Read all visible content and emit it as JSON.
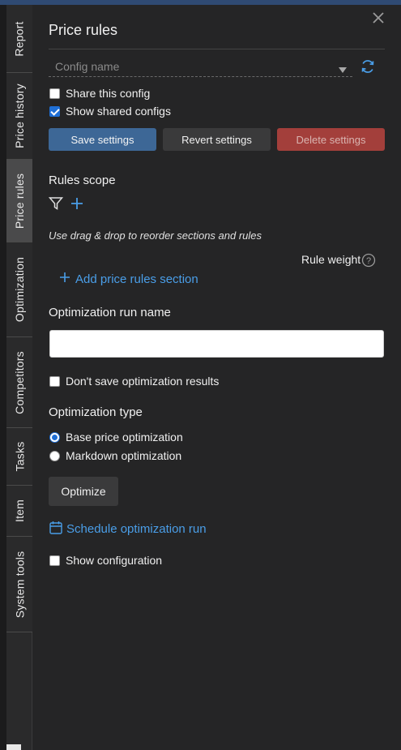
{
  "sidebar": {
    "tabs": [
      {
        "label": "Report",
        "active": false
      },
      {
        "label": "Price history",
        "active": false
      },
      {
        "label": "Price rules",
        "active": true
      },
      {
        "label": "Optimization",
        "active": false
      },
      {
        "label": "Competitors",
        "active": false
      },
      {
        "label": "Tasks",
        "active": false
      },
      {
        "label": "Item",
        "active": false
      },
      {
        "label": "System tools",
        "active": false
      }
    ]
  },
  "panel": {
    "title": "Price rules",
    "config_select": {
      "placeholder": "Config name",
      "value": ""
    },
    "share_config": {
      "label": "Share this config",
      "checked": false
    },
    "show_shared": {
      "label": "Show shared configs",
      "checked": true
    },
    "buttons": {
      "save": "Save settings",
      "revert": "Revert settings",
      "delete": "Delete settings"
    },
    "rules_scope_label": "Rules scope",
    "hint": "Use drag & drop to reorder sections and rules",
    "rule_weight_label": "Rule weight",
    "add_section_label": "Add price rules section",
    "optimization_run_name_label": "Optimization run name",
    "optimization_run_name_value": "",
    "dont_save": {
      "label": "Don't save optimization results",
      "checked": false
    },
    "optimization_type_label": "Optimization type",
    "optimization_types": [
      {
        "label": "Base price optimization",
        "selected": true
      },
      {
        "label": "Markdown optimization",
        "selected": false
      }
    ],
    "optimize_button": "Optimize",
    "schedule_link": "Schedule optimization run",
    "show_configuration": {
      "label": "Show configuration",
      "checked": false
    }
  },
  "colors": {
    "background": "#252526",
    "accent_link": "#4a9ee8",
    "save_button": "#3d6796",
    "delete_button": "#a33f3b",
    "checkbox_checked": "#1f6fd6"
  },
  "icons": {
    "close": "close-icon",
    "dropdown": "caret-down-icon",
    "refresh": "refresh-icon",
    "filter": "filter-icon",
    "add": "plus-icon",
    "help": "help-icon",
    "calendar": "calendar-icon"
  }
}
